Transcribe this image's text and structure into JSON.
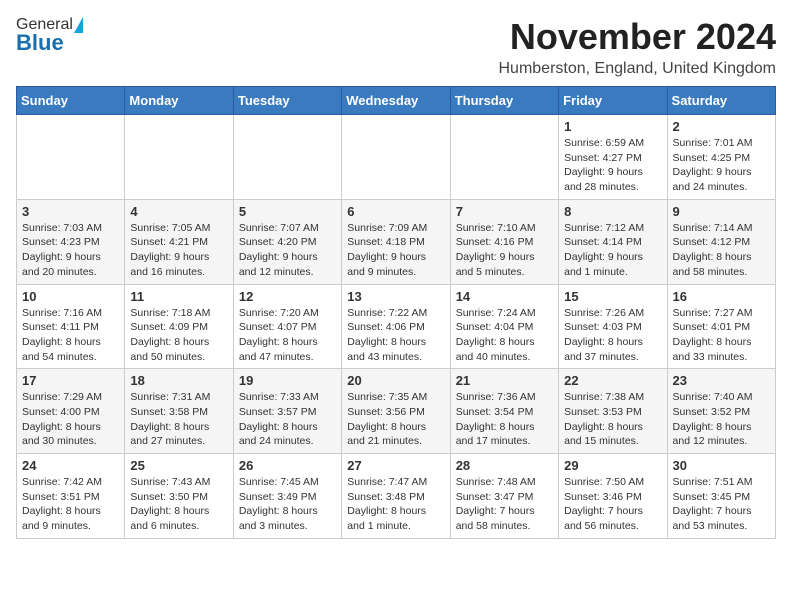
{
  "header": {
    "logo_line1": "General",
    "logo_line2": "Blue",
    "month": "November 2024",
    "location": "Humberston, England, United Kingdom"
  },
  "weekdays": [
    "Sunday",
    "Monday",
    "Tuesday",
    "Wednesday",
    "Thursday",
    "Friday",
    "Saturday"
  ],
  "weeks": [
    [
      {
        "day": "",
        "info": ""
      },
      {
        "day": "",
        "info": ""
      },
      {
        "day": "",
        "info": ""
      },
      {
        "day": "",
        "info": ""
      },
      {
        "day": "",
        "info": ""
      },
      {
        "day": "1",
        "info": "Sunrise: 6:59 AM\nSunset: 4:27 PM\nDaylight: 9 hours and 28 minutes."
      },
      {
        "day": "2",
        "info": "Sunrise: 7:01 AM\nSunset: 4:25 PM\nDaylight: 9 hours and 24 minutes."
      }
    ],
    [
      {
        "day": "3",
        "info": "Sunrise: 7:03 AM\nSunset: 4:23 PM\nDaylight: 9 hours and 20 minutes."
      },
      {
        "day": "4",
        "info": "Sunrise: 7:05 AM\nSunset: 4:21 PM\nDaylight: 9 hours and 16 minutes."
      },
      {
        "day": "5",
        "info": "Sunrise: 7:07 AM\nSunset: 4:20 PM\nDaylight: 9 hours and 12 minutes."
      },
      {
        "day": "6",
        "info": "Sunrise: 7:09 AM\nSunset: 4:18 PM\nDaylight: 9 hours and 9 minutes."
      },
      {
        "day": "7",
        "info": "Sunrise: 7:10 AM\nSunset: 4:16 PM\nDaylight: 9 hours and 5 minutes."
      },
      {
        "day": "8",
        "info": "Sunrise: 7:12 AM\nSunset: 4:14 PM\nDaylight: 9 hours and 1 minute."
      },
      {
        "day": "9",
        "info": "Sunrise: 7:14 AM\nSunset: 4:12 PM\nDaylight: 8 hours and 58 minutes."
      }
    ],
    [
      {
        "day": "10",
        "info": "Sunrise: 7:16 AM\nSunset: 4:11 PM\nDaylight: 8 hours and 54 minutes."
      },
      {
        "day": "11",
        "info": "Sunrise: 7:18 AM\nSunset: 4:09 PM\nDaylight: 8 hours and 50 minutes."
      },
      {
        "day": "12",
        "info": "Sunrise: 7:20 AM\nSunset: 4:07 PM\nDaylight: 8 hours and 47 minutes."
      },
      {
        "day": "13",
        "info": "Sunrise: 7:22 AM\nSunset: 4:06 PM\nDaylight: 8 hours and 43 minutes."
      },
      {
        "day": "14",
        "info": "Sunrise: 7:24 AM\nSunset: 4:04 PM\nDaylight: 8 hours and 40 minutes."
      },
      {
        "day": "15",
        "info": "Sunrise: 7:26 AM\nSunset: 4:03 PM\nDaylight: 8 hours and 37 minutes."
      },
      {
        "day": "16",
        "info": "Sunrise: 7:27 AM\nSunset: 4:01 PM\nDaylight: 8 hours and 33 minutes."
      }
    ],
    [
      {
        "day": "17",
        "info": "Sunrise: 7:29 AM\nSunset: 4:00 PM\nDaylight: 8 hours and 30 minutes."
      },
      {
        "day": "18",
        "info": "Sunrise: 7:31 AM\nSunset: 3:58 PM\nDaylight: 8 hours and 27 minutes."
      },
      {
        "day": "19",
        "info": "Sunrise: 7:33 AM\nSunset: 3:57 PM\nDaylight: 8 hours and 24 minutes."
      },
      {
        "day": "20",
        "info": "Sunrise: 7:35 AM\nSunset: 3:56 PM\nDaylight: 8 hours and 21 minutes."
      },
      {
        "day": "21",
        "info": "Sunrise: 7:36 AM\nSunset: 3:54 PM\nDaylight: 8 hours and 17 minutes."
      },
      {
        "day": "22",
        "info": "Sunrise: 7:38 AM\nSunset: 3:53 PM\nDaylight: 8 hours and 15 minutes."
      },
      {
        "day": "23",
        "info": "Sunrise: 7:40 AM\nSunset: 3:52 PM\nDaylight: 8 hours and 12 minutes."
      }
    ],
    [
      {
        "day": "24",
        "info": "Sunrise: 7:42 AM\nSunset: 3:51 PM\nDaylight: 8 hours and 9 minutes."
      },
      {
        "day": "25",
        "info": "Sunrise: 7:43 AM\nSunset: 3:50 PM\nDaylight: 8 hours and 6 minutes."
      },
      {
        "day": "26",
        "info": "Sunrise: 7:45 AM\nSunset: 3:49 PM\nDaylight: 8 hours and 3 minutes."
      },
      {
        "day": "27",
        "info": "Sunrise: 7:47 AM\nSunset: 3:48 PM\nDaylight: 8 hours and 1 minute."
      },
      {
        "day": "28",
        "info": "Sunrise: 7:48 AM\nSunset: 3:47 PM\nDaylight: 7 hours and 58 minutes."
      },
      {
        "day": "29",
        "info": "Sunrise: 7:50 AM\nSunset: 3:46 PM\nDaylight: 7 hours and 56 minutes."
      },
      {
        "day": "30",
        "info": "Sunrise: 7:51 AM\nSunset: 3:45 PM\nDaylight: 7 hours and 53 minutes."
      }
    ]
  ]
}
